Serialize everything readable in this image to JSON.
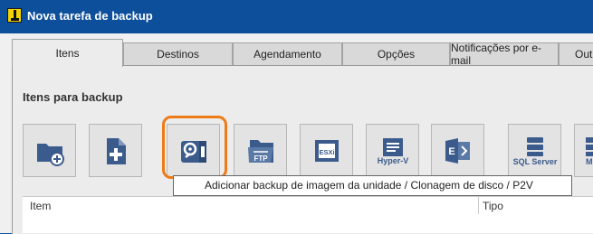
{
  "window": {
    "title": "Nova tarefa de backup",
    "app_icon": "iperius-logo-icon"
  },
  "tabs": [
    {
      "label": "Itens",
      "active": true
    },
    {
      "label": "Destinos",
      "active": false
    },
    {
      "label": "Agendamento",
      "active": false
    },
    {
      "label": "Opções",
      "active": false
    },
    {
      "label": "Notificações por e-mail",
      "active": false
    },
    {
      "label": "Outr",
      "active": false
    }
  ],
  "section": {
    "title": "Itens para backup"
  },
  "toolbar": {
    "buttons": [
      {
        "icon": "add-folder-icon"
      },
      {
        "icon": "add-file-icon"
      },
      {
        "icon": "drive-image-icon"
      },
      {
        "icon": "ftp-icon",
        "label": "FTP"
      },
      {
        "icon": "esxi-icon",
        "label": "ESXi"
      },
      {
        "icon": "hyper-v-icon",
        "label": "Hyper-V"
      },
      {
        "icon": "exchange-icon"
      },
      {
        "icon": "sql-server-icon",
        "label": "SQL Server"
      },
      {
        "icon": "mysql-icon",
        "label": "M"
      }
    ]
  },
  "tooltip": {
    "text": "Adicionar backup de imagem da unidade / Clonagem de disco / P2V"
  },
  "table": {
    "columns": [
      "Item",
      "Tipo"
    ]
  },
  "colors": {
    "title_bar": "#0d4f9a",
    "icon_blue": "#3b5b8c",
    "highlight": "#ef7b17"
  }
}
